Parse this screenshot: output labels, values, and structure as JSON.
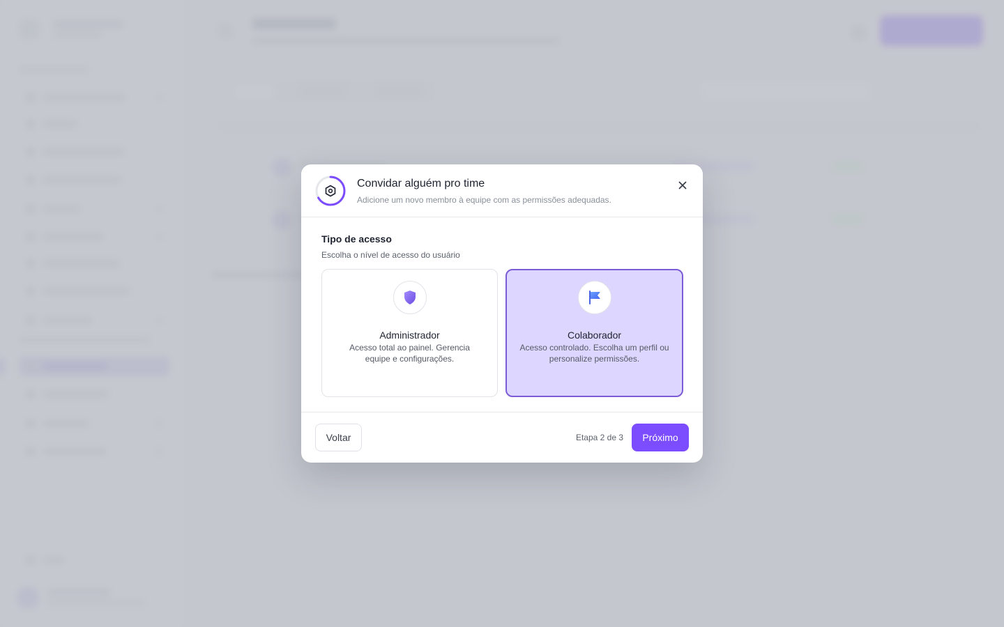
{
  "modal": {
    "title": "Convidar alguém pro time",
    "subtitle": "Adicione um novo membro à equipe com as permissões adequadas.",
    "section_label": "Tipo de acesso",
    "section_help": "Escolha o nível de acesso do usuário",
    "options": [
      {
        "title": "Administrador",
        "description": "Acesso total ao painel. Gerencia equipe e configurações.",
        "icon": "shield-icon",
        "selected": false
      },
      {
        "title": "Colaborador",
        "description": "Acesso controlado. Escolha um perfil ou personalize permissões.",
        "icon": "flag-icon",
        "selected": true
      }
    ],
    "back_label": "Voltar",
    "step_text": "Etapa 2 de 3",
    "next_label": "Próximo",
    "progress": {
      "current_step": 2,
      "total_steps": 3
    }
  },
  "colors": {
    "accent": "#7c4dff",
    "selected_card_bg": "#ddd6fe",
    "selected_card_border": "#7c5cd6"
  }
}
